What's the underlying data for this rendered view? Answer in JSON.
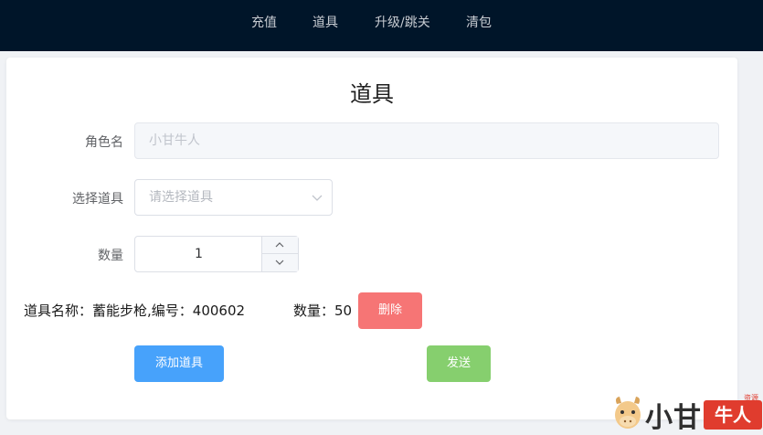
{
  "nav": {
    "items": [
      "充值",
      "道具",
      "升级/跳关",
      "清包"
    ]
  },
  "form": {
    "title": "道具",
    "role_label": "角色名",
    "role_placeholder": "小甘牛人",
    "select_label": "选择道具",
    "select_placeholder": "请选择道具",
    "quantity_label": "数量",
    "quantity_value": "1"
  },
  "item": {
    "name_label": "道具名称：",
    "name_value": "蓄能步枪,编号：400602",
    "count_label": "数量：",
    "count_value": "50",
    "delete_label": "删除"
  },
  "actions": {
    "add_label": "添加道具",
    "send_label": "发送"
  },
  "watermark": {
    "text": "小甘",
    "badge": "牛人",
    "small": "资源网"
  },
  "colors": {
    "header_bg": "#001529",
    "primary": "#47a2fb",
    "danger": "#f67575",
    "success": "#86cf6e"
  },
  "icons": {
    "select": "chevron-down-icon",
    "stepper_up": "chevron-up-icon",
    "stepper_down": "chevron-down-icon"
  }
}
